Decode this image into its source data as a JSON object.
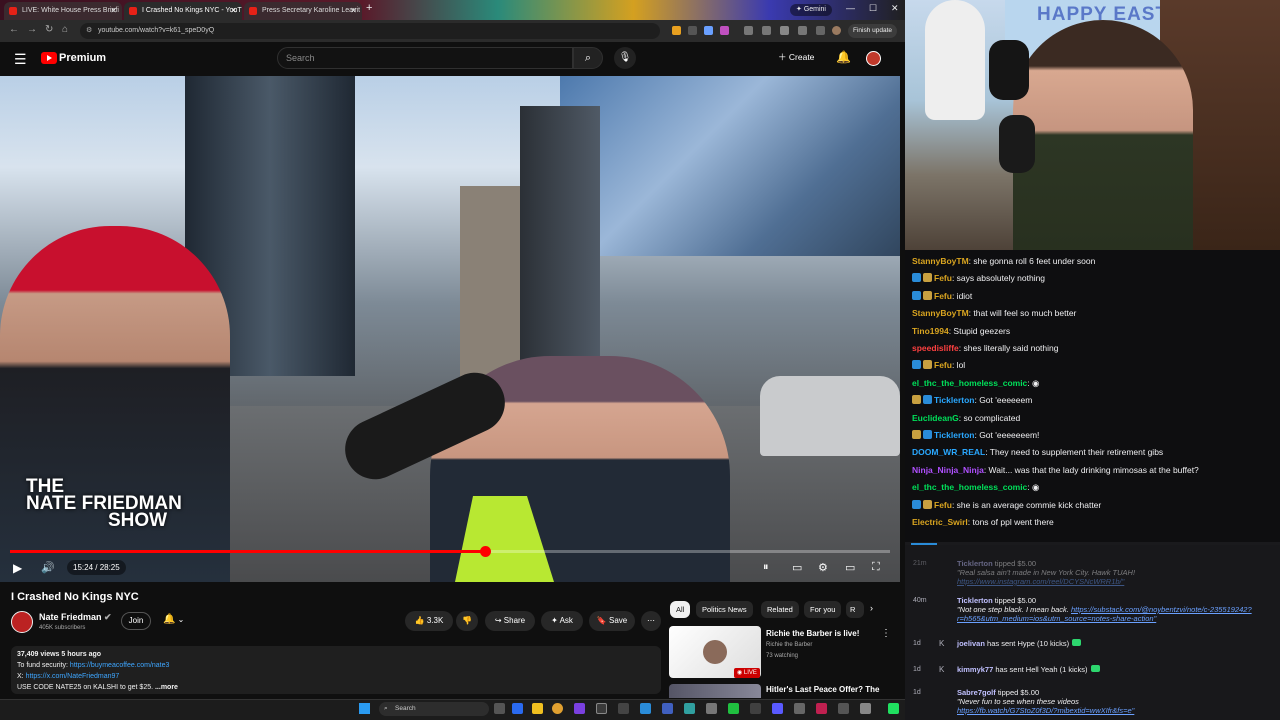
{
  "browser": {
    "tabs": [
      {
        "label": "LIVE: White House Press Briefi"
      },
      {
        "label": "I Crashed No Kings NYC - YouT"
      },
      {
        "label": "Press Secretary Karoline Leavit"
      }
    ],
    "gemini_label": "Gemini",
    "url": "youtube.com/watch?v=k61_speD0yQ",
    "update_label": "Finish update"
  },
  "youtube": {
    "brand": "Premium",
    "search_placeholder": "Search",
    "create_label": "Create",
    "video": {
      "overlay_title": [
        "THE",
        "NATE FRIEDMAN",
        "SHOW"
      ],
      "time": "15:24 / 28:25",
      "progress": 0.54
    },
    "title": "I Crashed No Kings NYC",
    "channel": {
      "name": "Nate Friedman",
      "subs": "405K subscribers",
      "join_label": "Join"
    },
    "actions": {
      "likes": "3.3K",
      "share": "Share",
      "ask": "Ask",
      "save": "Save"
    },
    "description": {
      "meta": "37,409 views  5 hours ago",
      "line1_prefix": "To fund security: ",
      "line1_link": "https://buymeacoffee.com/nate3",
      "line2_prefix": "X: ",
      "line2_link": "https://x.com/NateFriedman97",
      "line3": "USE CODE NATE25 on KALSHI to get $25.",
      "more": " ...more"
    },
    "chips": [
      "All",
      "Politics News",
      "Related",
      "For you",
      "R"
    ],
    "recommendations": [
      {
        "title": "Richie the Barber is live!",
        "channel": "Richie the Barber",
        "meta": "73 watching",
        "badge": "LIVE"
      },
      {
        "title": "Hitler's Last Peace Offer? The"
      }
    ]
  },
  "taskbar": {
    "search_placeholder": "Search"
  },
  "webcam": {
    "banner": "HAPPY EASTER"
  },
  "chat": [
    {
      "user": "StannyBoyTM",
      "color": "#daa520",
      "badges": [],
      "msg": ": she gonna roll 6 feet under soon"
    },
    {
      "user": "Fefu",
      "color": "#daa520",
      "badges": [
        "#2a8cd9",
        "#c8a040"
      ],
      "msg": ": says absolutely nothing"
    },
    {
      "user": "Fefu",
      "color": "#daa520",
      "badges": [
        "#2a8cd9",
        "#c8a040"
      ],
      "msg": ": idiot"
    },
    {
      "user": "StannyBoyTM",
      "color": "#daa520",
      "badges": [],
      "msg": ": that will feel so much better"
    },
    {
      "user": "Tino1994",
      "color": "#daa520",
      "badges": [],
      "msg": ": Stupid geezers"
    },
    {
      "user": "speedisliffe",
      "color": "#ff4040",
      "badges": [],
      "msg": ": shes literally said nothing"
    },
    {
      "user": "Fefu",
      "color": "#daa520",
      "badges": [
        "#2a8cd9",
        "#c8a040"
      ],
      "msg": ": lol"
    },
    {
      "user": "el_thc_the_homeless_comic",
      "color": "#00e05a",
      "badges": [],
      "msg": ": ◉"
    },
    {
      "user": "Ticklerton",
      "color": "#2aa8ff",
      "badges": [
        "#c8a040",
        "#2a8cd9"
      ],
      "msg": ": Got 'eeeeeem"
    },
    {
      "user": "EuclideanG",
      "color": "#00e05a",
      "badges": [],
      "msg": ": so complicated"
    },
    {
      "user": "Ticklerton",
      "color": "#2aa8ff",
      "badges": [
        "#c8a040",
        "#2a8cd9"
      ],
      "msg": ": Got 'eeeeeeem!"
    },
    {
      "user": "DOOM_WR_REAL",
      "color": "#2aa8ff",
      "badges": [],
      "msg": ": They need to supplement their retirement gibs"
    },
    {
      "user": "Ninja_Ninja_Ninja",
      "color": "#b050ff",
      "badges": [],
      "msg": ": Wait... was that the lady drinking mimosas at the buffet?"
    },
    {
      "user": "el_thc_the_homeless_comic",
      "color": "#00e05a",
      "badges": [],
      "msg": ": ◉"
    },
    {
      "user": "Fefu",
      "color": "#daa520",
      "badges": [
        "#2a8cd9",
        "#c8a040"
      ],
      "msg": ": she is an average commie kick chatter"
    },
    {
      "user": "Electric_Swirl",
      "color": "#daa520",
      "badges": [],
      "msg": ": tons of ppl went there"
    }
  ],
  "events": [
    {
      "time": "21m",
      "name": "Ticklerton",
      "action": " tipped $5.00",
      "quote": "\"Real salsa ain't made in New York City. Hawk TUAH!",
      "link": "https://www.instagram.com/reel/DCYSNcWRR1b/\"",
      "dim": true
    },
    {
      "time": "40m",
      "name": "Ticklerton",
      "action": " tipped $5.00",
      "quote": "\"Not one step black. I mean back. ",
      "link": "https://substack.com/@noybentzvi/note/c-235519242?r=h565&utm_medium=ios&utm_source=notes-share-action\"",
      "dim": false
    },
    {
      "time": "1d",
      "name": "joelivan",
      "action": " has sent Hype (10 kicks)",
      "quote": "",
      "link": "",
      "dim": false
    },
    {
      "time": "1d",
      "name": "kimmyk77",
      "action": " has sent Hell Yeah (1 kicks)",
      "quote": "",
      "link": "",
      "dim": false
    },
    {
      "time": "1d",
      "name": "Sabre7golf",
      "action": " tipped $5.00",
      "quote": "\"Never fun to see when these videos",
      "link": "https://fb.watch/G7StoZ0f3D/?mibextid=wwXIfr&fs=e\"",
      "dim": false
    }
  ]
}
